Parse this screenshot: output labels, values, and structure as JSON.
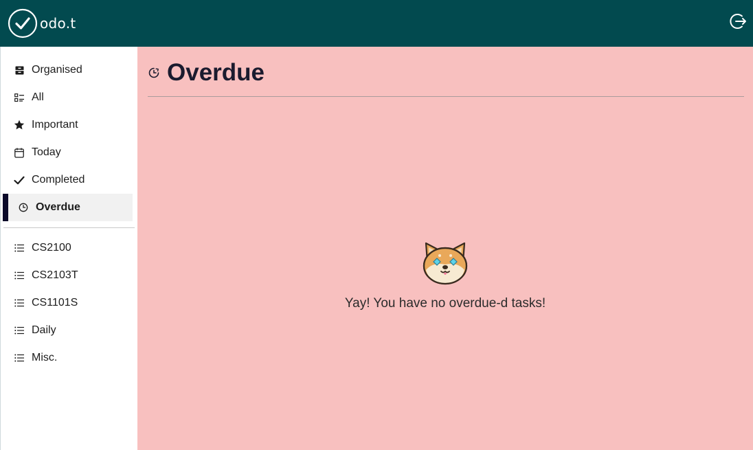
{
  "app": {
    "logo_text": "odo.t"
  },
  "sidebar": {
    "primary": [
      {
        "label": "Organised",
        "icon": "archive-icon"
      },
      {
        "label": "All",
        "icon": "checklist-icon"
      },
      {
        "label": "Important",
        "icon": "star-icon"
      },
      {
        "label": "Today",
        "icon": "calendar-icon"
      },
      {
        "label": "Completed",
        "icon": "check-icon"
      },
      {
        "label": "Overdue",
        "icon": "clock-icon",
        "active": true
      }
    ],
    "lists": [
      {
        "label": "CS2100",
        "icon": "list-icon"
      },
      {
        "label": "CS2103T",
        "icon": "list-icon"
      },
      {
        "label": "CS1101S",
        "icon": "list-icon"
      },
      {
        "label": "Daily",
        "icon": "list-icon"
      },
      {
        "label": "Misc.",
        "icon": "list-icon"
      }
    ]
  },
  "main": {
    "title": "Overdue",
    "empty_message": "Yay! You have no overdue-d tasks!"
  },
  "colors": {
    "topbar": "#024a4f",
    "main_background": "#f8c0bf",
    "active_indicator": "#0b0a2a"
  }
}
